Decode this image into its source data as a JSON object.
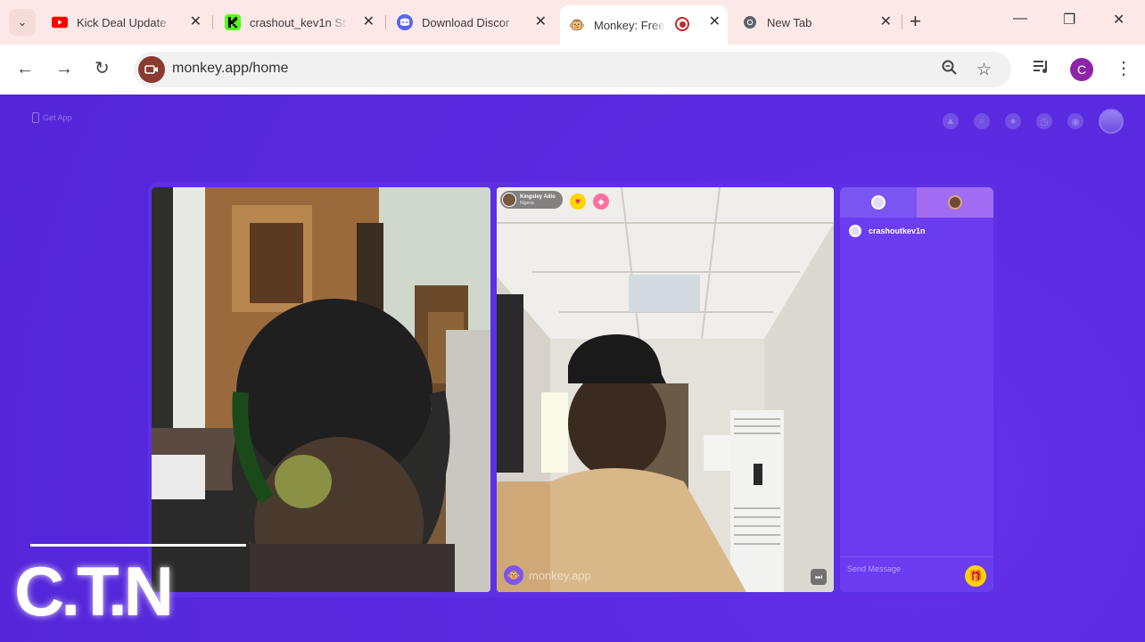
{
  "browser": {
    "tabs": [
      {
        "title": "Kick Deal Update",
        "icon": "youtube-icon",
        "active": false
      },
      {
        "title": "crashout_kev1n St",
        "icon": "kick-icon",
        "active": false
      },
      {
        "title": "Download Discor",
        "icon": "discord-icon",
        "active": false
      },
      {
        "title": "Monkey: Free",
        "icon": "monkey-icon",
        "active": true
      },
      {
        "title": "New Tab",
        "icon": "chrome-icon",
        "active": false
      }
    ],
    "url": "monkey.app/home",
    "profile_initial": "C"
  },
  "app": {
    "get_app_label": "Get App",
    "peer": {
      "name": "Kingsley Adio",
      "country": "Nigeria"
    },
    "watermark": "monkey.app",
    "chat": {
      "messages": [
        {
          "user": "crashoutkev1n"
        }
      ],
      "input_placeholder": "Send Message"
    }
  },
  "overlay": {
    "logo_text": "C.T.N"
  },
  "colors": {
    "app_bg": "#5b2be0",
    "tabbar_bg": "#fce9e7",
    "accent_yellow": "#ffd200"
  }
}
